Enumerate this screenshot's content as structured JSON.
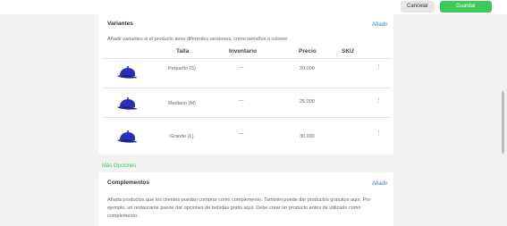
{
  "toolbar": {
    "cancel_label": "Cancelar",
    "save_label": "Guardar"
  },
  "variants": {
    "title": "Variantes",
    "add_label": "Añadir",
    "description": "Añadir variantes si el producto tiene diferentes versiones, como tamaños o colores",
    "columns": [
      "Talla",
      "Inventario",
      "Precio",
      "SKU"
    ],
    "rows": [
      {
        "size": "Pequeño (S)",
        "inventory": "—",
        "price": "20.000"
      },
      {
        "size": "Mediano (M)",
        "inventory": "—",
        "price": "25.000"
      },
      {
        "size": "Grande (L)",
        "inventory": "—",
        "price": "30.000"
      }
    ],
    "menu_icon": "⋮"
  },
  "more_options": "Más Opciones",
  "complements": {
    "title": "Complementos",
    "add_label": "Añadir",
    "description": "Añada productos que los clientes puedan comprar como complemento. También puede dar productos gratuitos aquí. Por ejemplo, un restaurante puede dar opciones de bebidas gratis aquí. Debe crear un producto antes de utilizarlo como complemento."
  },
  "colors": {
    "accent": "#3cc95a",
    "link": "#2d7fd3",
    "cap": "#2a2fb5"
  },
  "icons": {
    "product_image": "cap-image",
    "row_menu": "more-vertical-icon"
  }
}
